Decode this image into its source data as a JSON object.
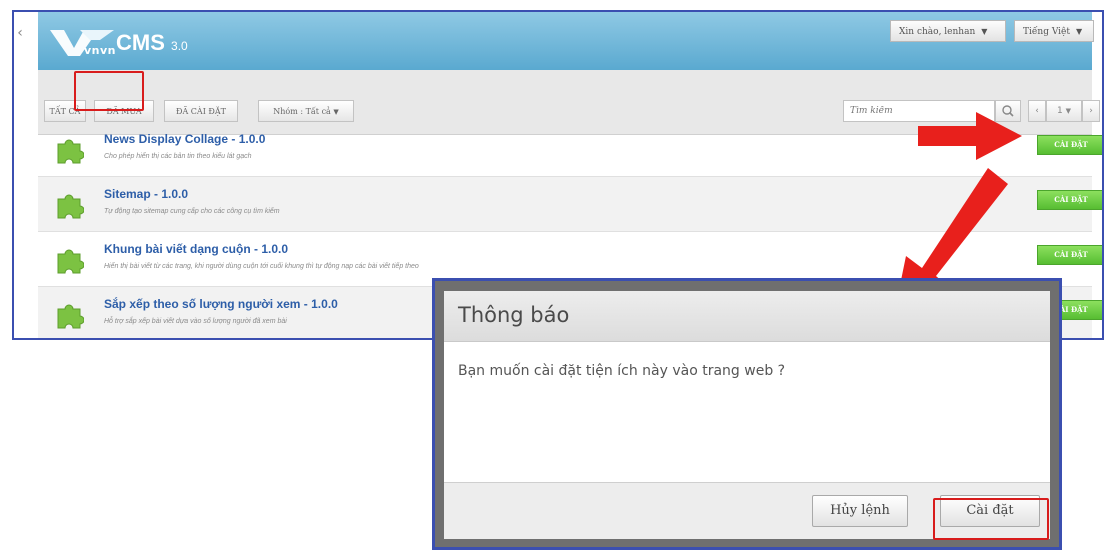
{
  "header": {
    "brand_prefix": "vnvn",
    "brand_name": "CMS",
    "brand_version": "3.0",
    "greeting": "Xin chào, lenhan",
    "language": "Tiếng Việt"
  },
  "toolbar": {
    "tabs": [
      {
        "label": "Tất cả"
      },
      {
        "label": "Đã mua"
      },
      {
        "label": "Đã cài đặt"
      }
    ],
    "group_filter": "Nhóm : Tất cả",
    "search_placeholder": "Tìm kiếm",
    "page_value": "1"
  },
  "plugins": [
    {
      "title": "News Display Collage - 1.0.0",
      "desc": "Cho phép hiển thị các bản tin theo kiểu lát gạch",
      "action": "Cài đặt"
    },
    {
      "title": "Sitemap - 1.0.0",
      "desc": "Tự động tạo sitemap cung cấp cho các công cụ tìm kiếm",
      "action": "Cài đặt"
    },
    {
      "title": "Khung bài viết dạng cuộn - 1.0.0",
      "desc": "Hiển thị bài viết từ các trang, khi người dùng cuộn tới cuối khung thì tự động nạp các bài viết tiếp theo",
      "action": "Cài đặt"
    },
    {
      "title": "Sắp xếp theo số lượng người xem - 1.0.0",
      "desc": "Hỗ trợ sắp xếp bài viết dựa vào số lượng người đã xem bài",
      "action": "Cài đặt"
    }
  ],
  "dialog": {
    "title": "Thông báo",
    "message": "Bạn muốn cài đặt tiện ích này vào trang web ?",
    "cancel_label": "Hủy lệnh",
    "confirm_label": "Cài đặt"
  },
  "colors": {
    "accent_blue": "#3b4fb0",
    "install_green": "#57bd32",
    "highlight_red": "#d81c1c",
    "arrow_red": "#e8201c"
  }
}
